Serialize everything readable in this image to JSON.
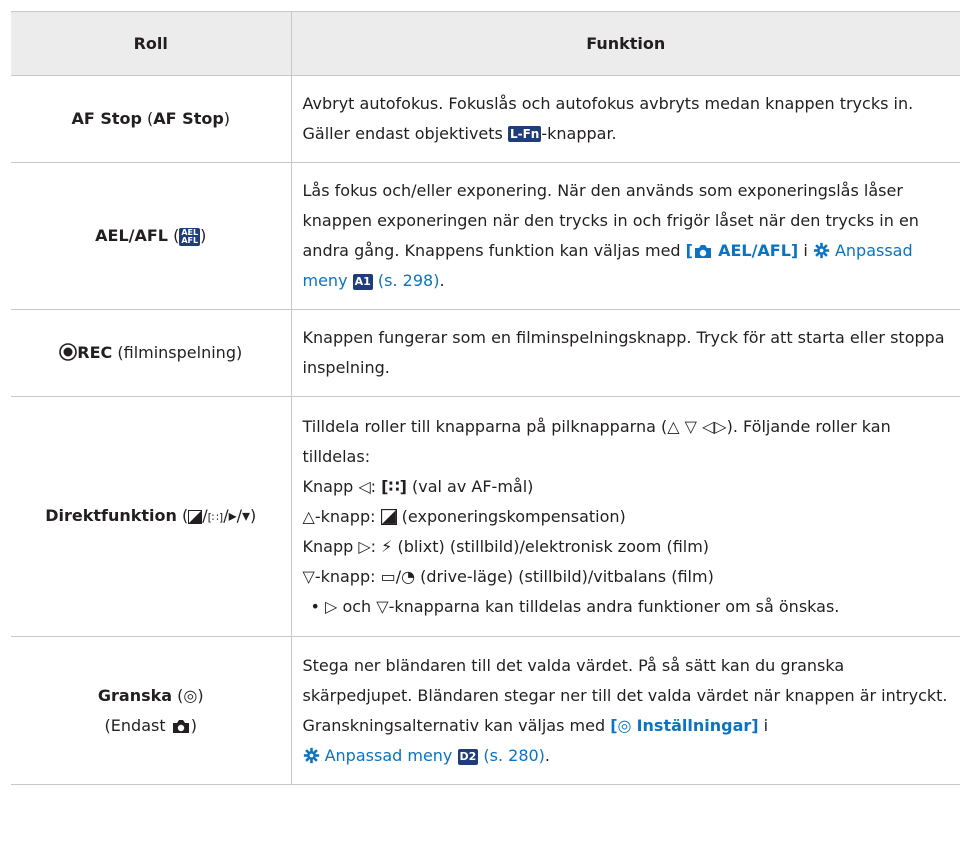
{
  "header": {
    "col1": "Roll",
    "col2": "Funktion"
  },
  "rows": {
    "afstop": {
      "role_name": "AF Stop",
      "role_paren": "AF Stop",
      "desc_a": "Avbryt autofokus. Fokuslås och autofokus avbryts medan knappen trycks in. Gäller endast objektivets ",
      "lfn": "L-Fn",
      "desc_b": "-knappar."
    },
    "ael": {
      "role_name": "AEL/AFL",
      "badge_top": "AEL",
      "badge_bot": "AFL",
      "desc": "Lås fokus och/eller exponering. När den används som exponeringslås låser knappen exponeringen när den trycks in och frigör låset när den trycks in en andra gång. Knappens funktion kan väljas med ",
      "link_bracket_open": "[",
      "link_title": "AEL/AFL]",
      "link_i": " i ",
      "link_menu": "Anpassad meny",
      "badge_menu": "A1",
      "link_page": "(s. 298)",
      "end": "."
    },
    "rec": {
      "role_bold": "REC",
      "role_rest": " (filminspelning)",
      "desc": "Knappen fungerar som en filminspelningsknapp. Tryck för att starta eller stoppa inspelning."
    },
    "direct": {
      "role_name": "Direktfunktion",
      "line1_a": "Tilldela roller till knapparna på pilknapparna (",
      "line1_b": "). Följande roller kan tilldelas:",
      "line2_a": "Knapp ",
      "line2_b": ": ",
      "line2_c": " (val av AF-mål)",
      "line3_a": "-knapp: ",
      "line3_b": " (exponeringskompensation)",
      "line4_a": "Knapp ",
      "line4_b": ": ",
      "line4_c": " (blixt) (stillbild)/elektronisk zoom (film)",
      "line5_a": "-knapp: ",
      "line5_b": " (drive-läge) (stillbild)/vitbalans (film)",
      "bullet_a": "och ",
      "bullet_b": "-knapparna kan tilldelas andra funktioner om så önskas."
    },
    "preview": {
      "role_name": "Granska",
      "role_sub": "(Endast ",
      "role_sub_end": ")",
      "desc": "Stega ner bländaren till det valda värdet. På så sätt kan du granska skärpedjupet. Bländaren stegar ner till det valda värdet när knappen är intryckt. Granskningsalternativ kan väljas med ",
      "link_bracket_open": "[",
      "link_title": "Inställningar]",
      "link_i": " i",
      "link_menu": "Anpassad meny",
      "badge_menu": "D2",
      "link_page": "(s. 280)",
      "end": "."
    }
  }
}
